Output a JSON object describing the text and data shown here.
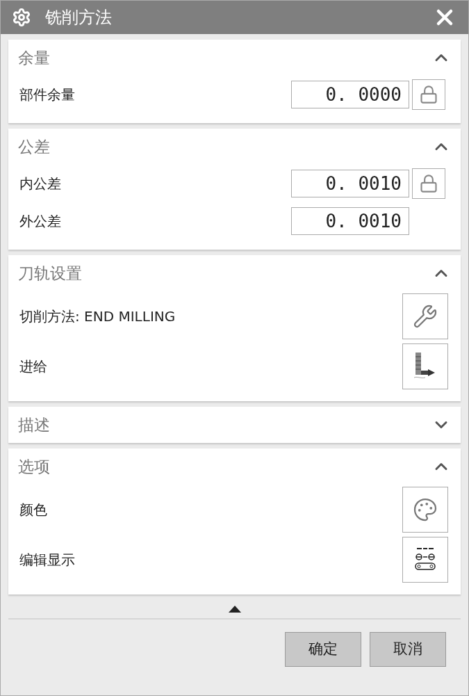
{
  "window": {
    "title": "铣削方法"
  },
  "sections": [
    {
      "title": "余量",
      "expanded": true,
      "rows": [
        {
          "kind": "field",
          "label": "部件余量",
          "value": "0. 0000",
          "lock": true
        }
      ]
    },
    {
      "title": "公差",
      "expanded": true,
      "rows": [
        {
          "kind": "field",
          "label": "内公差",
          "value": "0. 0010",
          "lock": true
        },
        {
          "kind": "field",
          "label": "外公差",
          "value": "0. 0010",
          "lock": false
        }
      ]
    },
    {
      "title": "刀轨设置",
      "expanded": true,
      "rows": [
        {
          "kind": "wrench",
          "label": "切削方法: END MILLING"
        },
        {
          "kind": "feed",
          "label": "进给"
        }
      ]
    },
    {
      "title": "描述",
      "expanded": false
    },
    {
      "title": "选项",
      "expanded": true,
      "rows": [
        {
          "kind": "palette",
          "label": "颜色"
        },
        {
          "kind": "display",
          "label": "编辑显示"
        }
      ]
    }
  ],
  "buttons": [
    "确定",
    "取消"
  ]
}
